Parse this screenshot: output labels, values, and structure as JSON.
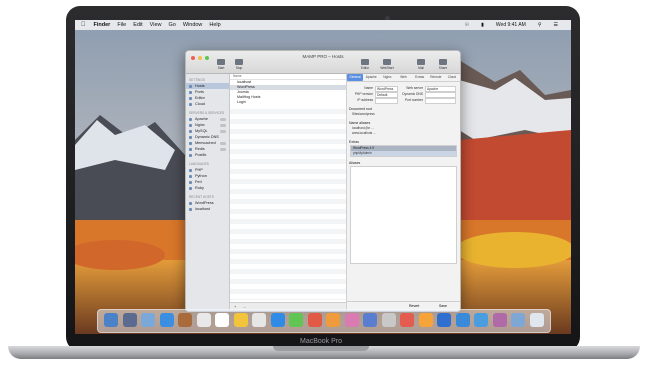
{
  "device": {
    "model_label": "MacBook Pro"
  },
  "menubar": {
    "items": [
      "Finder",
      "File",
      "Edit",
      "View",
      "Go",
      "Window",
      "Help"
    ],
    "clock": "Wed 9:41 AM"
  },
  "window": {
    "title": "MAMP PRO – Hosts",
    "toolbar": [
      "Start",
      "Stop",
      "Editor",
      "WebStart",
      "Mail",
      "Share"
    ],
    "sidebar": {
      "sections": [
        {
          "header": "SETTINGS",
          "items": [
            "Hosts",
            "Ports",
            "Editor",
            "Cloud"
          ]
        },
        {
          "header": "SERVERS & SERVICES",
          "items": [
            "Apache",
            "Nginx",
            "MySQL",
            "Dynamic DNS",
            "Memcached",
            "Redis",
            "Postfix"
          ]
        },
        {
          "header": "LANGUAGES",
          "items": [
            "PHP",
            "Python",
            "Perl",
            "Ruby"
          ]
        },
        {
          "header": "RECENT HOSTS",
          "items": [
            "WordPress",
            "localhost"
          ]
        }
      ]
    },
    "hosts": {
      "header": "Name",
      "list": [
        "localhost",
        "WordPress",
        "Joomla",
        "MailHog Hosts",
        "Login"
      ]
    },
    "detail": {
      "tabs": [
        "General",
        "Apache",
        "Nginx",
        "Web",
        "Extras",
        "Remote",
        "Cloud"
      ],
      "fields": [
        {
          "label": "Name",
          "value": "WordPress",
          "label2": "Web server",
          "value2": "Apache"
        },
        {
          "label": "PHP version",
          "value": "Default",
          "label2": "Dynamic DNS",
          "value2": ""
        },
        {
          "label": "IP address",
          "value": "",
          "label2": "Port number",
          "value2": ""
        }
      ],
      "doc_root_label": "Document root",
      "doc_root_value": "Sites/wordpress",
      "section_aliases": "Name aliases",
      "radio1": "localhost (for ...",
      "radio2": "www.localhost ...",
      "section_extras": "Extras",
      "extras_rows": [
        "WordPress 4.9",
        "phpMyAdmin"
      ],
      "section_aliases2": "Aliases",
      "buttons": [
        "Revert",
        "Save"
      ]
    },
    "footer_buttons": [
      "+",
      "–"
    ]
  },
  "dock": {
    "colors": [
      "#4b82c7",
      "#5b6b8f",
      "#7aa8d8",
      "#3c8fe0",
      "#a96b3b",
      "#e8e8e8",
      "#ffffff",
      "#f2c43c",
      "#e6e6e6",
      "#2f8be6",
      "#61c554",
      "#e05a45",
      "#ef9a3c",
      "#d97bb2",
      "#5a7ecf",
      "#c8c8c8",
      "#e35c4f",
      "#f6a33a",
      "#2f6fd0",
      "#3b8ad9",
      "#4a9ee0",
      "#b06aa8",
      "#7fa7d6",
      "#e0e6ee"
    ]
  }
}
